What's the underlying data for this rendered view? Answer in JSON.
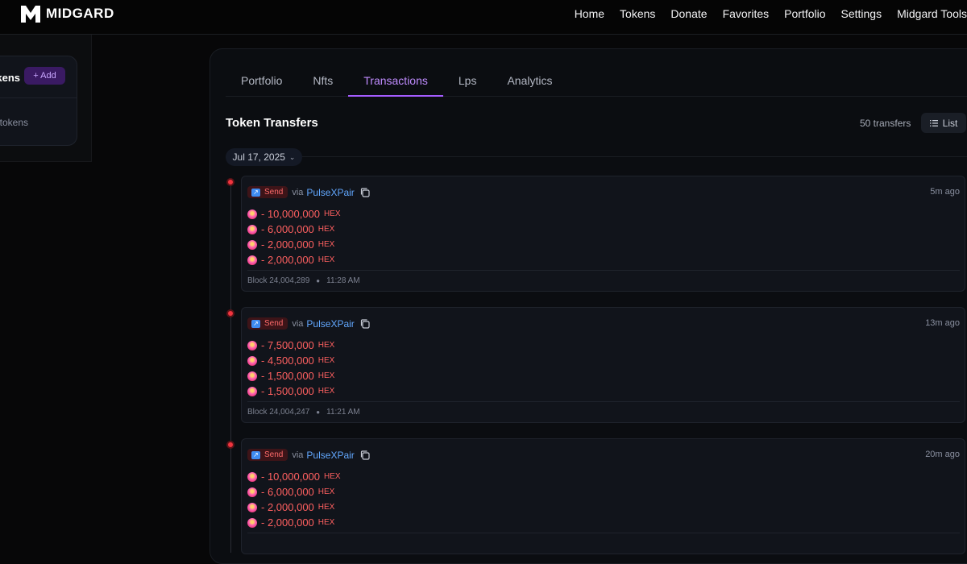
{
  "brand": {
    "name": "MIDGARD"
  },
  "nav": [
    "Home",
    "Tokens",
    "Donate",
    "Favorites",
    "Portfolio",
    "Settings",
    "Midgard Tools"
  ],
  "sidebar": {
    "title": "kens",
    "add_label": "+ Add",
    "empty_text": "tokens"
  },
  "tabs": [
    "Portfolio",
    "Nfts",
    "Transactions",
    "Lps",
    "Analytics"
  ],
  "active_tab": "Transactions",
  "section": {
    "title": "Token Transfers",
    "count": "50 transfers",
    "view_label": "List"
  },
  "date_group": {
    "label": "Jul 17, 2025"
  },
  "transactions": [
    {
      "type": "Send",
      "via": "via",
      "pair": "PulseXPair",
      "time": "5m ago",
      "amounts": [
        {
          "value": "- 10,000,000",
          "symbol": "HEX"
        },
        {
          "value": "- 6,000,000",
          "symbol": "HEX"
        },
        {
          "value": "- 2,000,000",
          "symbol": "HEX"
        },
        {
          "value": "- 2,000,000",
          "symbol": "HEX"
        }
      ],
      "block": "Block 24,004,289",
      "clock": "11:28 AM"
    },
    {
      "type": "Send",
      "via": "via",
      "pair": "PulseXPair",
      "time": "13m ago",
      "amounts": [
        {
          "value": "- 7,500,000",
          "symbol": "HEX"
        },
        {
          "value": "- 4,500,000",
          "symbol": "HEX"
        },
        {
          "value": "- 1,500,000",
          "symbol": "HEX"
        },
        {
          "value": "- 1,500,000",
          "symbol": "HEX"
        }
      ],
      "block": "Block 24,004,247",
      "clock": "11:21 AM"
    },
    {
      "type": "Send",
      "via": "via",
      "pair": "PulseXPair",
      "time": "20m ago",
      "amounts": [
        {
          "value": "- 10,000,000",
          "symbol": "HEX"
        },
        {
          "value": "- 6,000,000",
          "symbol": "HEX"
        },
        {
          "value": "- 2,000,000",
          "symbol": "HEX"
        },
        {
          "value": "- 2,000,000",
          "symbol": "HEX"
        }
      ],
      "block": "",
      "clock": ""
    }
  ],
  "colors": {
    "accent": "#a45cff",
    "negative": "#ff6060",
    "link": "#62a8ff",
    "dot": "#f0353f"
  }
}
